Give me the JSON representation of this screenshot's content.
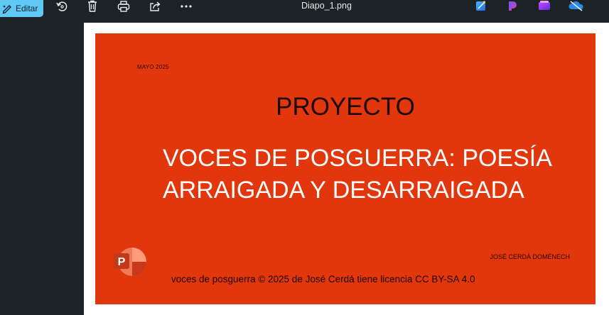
{
  "toolbar": {
    "edit_label": "Editar",
    "file_name": "Diapo_1.png",
    "icons": [
      "edit-pen-icon",
      "rotate-icon",
      "delete-icon",
      "print-icon",
      "share-icon",
      "more-icon"
    ],
    "apps": [
      "photo-editor-app-icon",
      "clipchamp-app-icon",
      "app-icon",
      "onedrive-sync-icon"
    ]
  },
  "slide": {
    "date": "MAYO 2025",
    "heading": "PROYECTO",
    "subtitle_line1": "VOCES DE POSGUERRA: POESÍA",
    "subtitle_line2": "ARRAIGADA Y DESARRAIGADA",
    "author": "JOSÉ CERDÁ DOMÉNECH",
    "license": "voces de posguerra © 2025 de José Cerdá tiene licencia CC BY-SA 4.0",
    "colors": {
      "background": "#e2360c",
      "title": "#1a0803",
      "subtitle": "#ffffff"
    }
  }
}
